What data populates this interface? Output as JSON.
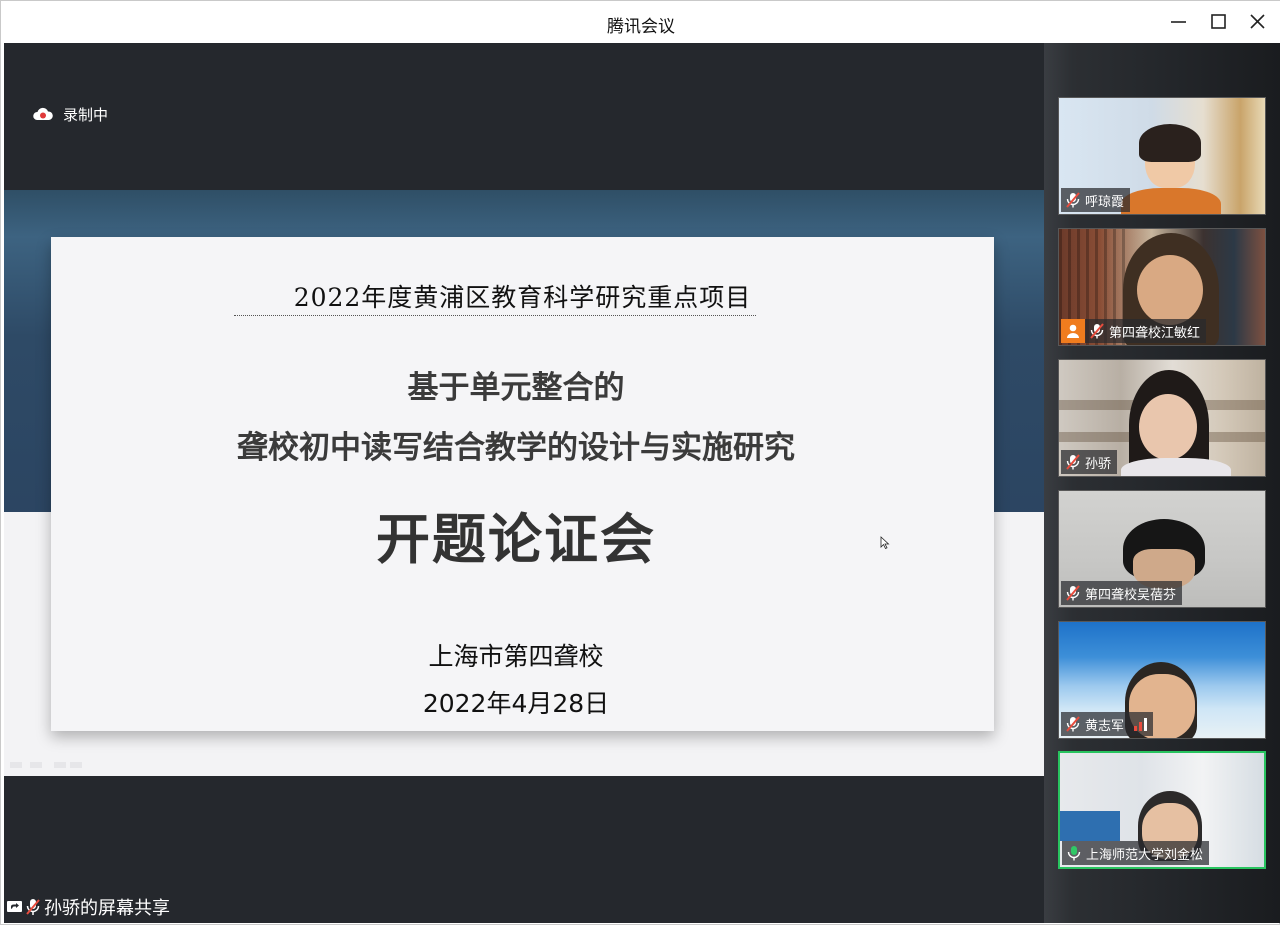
{
  "window": {
    "title": "腾讯会议"
  },
  "recording": {
    "label": "录制中"
  },
  "slide": {
    "top_line": "2022年度黄浦区教育科学研究重点项目",
    "title_line1": "基于单元整合的",
    "title_line2": "聋校初中读写结合教学的设计与实施研究",
    "headline": "开题论证会",
    "organization": "上海市第四聋校",
    "date": "2022年4月28日"
  },
  "screen_share": {
    "label": "孙骄的屏幕共享"
  },
  "participants": [
    {
      "name": "呼琼霞",
      "mic": "muted"
    },
    {
      "name": "第四聋校江敏红",
      "mic": "muted",
      "badge": "person-icon"
    },
    {
      "name": "孙骄",
      "mic": "muted"
    },
    {
      "name": "第四聋校吴蓓芬",
      "mic": "muted"
    },
    {
      "name": "黄志军",
      "mic": "muted",
      "signal": "weak"
    },
    {
      "name": "上海师范大学刘金松",
      "mic": "on",
      "active": true
    }
  ],
  "colors": {
    "active_border": "#28c45f",
    "muted_slash": "#e84c3d",
    "badge_orange": "#f07c1e"
  }
}
